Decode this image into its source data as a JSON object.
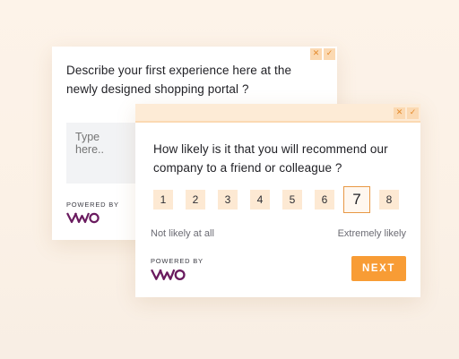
{
  "back_widget": {
    "question": "Describe your first experience here at the newly designed shopping portal ?",
    "input_placeholder": "Type here..",
    "powered_by": "POWERED BY",
    "logo_text": "VWO",
    "close_symbol": "✕",
    "minimize_symbol": "✓"
  },
  "front_widget": {
    "question": "How likely is it that you will recommend our company to a friend or colleague ?",
    "scale": [
      "1",
      "2",
      "3",
      "4",
      "5",
      "6",
      "7",
      "8"
    ],
    "selected": "7",
    "label_low": "Not likely at all",
    "label_high": "Extremely likely",
    "powered_by": "POWERED BY",
    "logo_text": "VWO",
    "next_label": "NEXT",
    "close_symbol": "✕",
    "minimize_symbol": "✓"
  },
  "colors": {
    "accent": "#f89c35",
    "accent_light": "#fde9d3",
    "logo": "#6a1b5f",
    "background": "#fdf3e9"
  }
}
